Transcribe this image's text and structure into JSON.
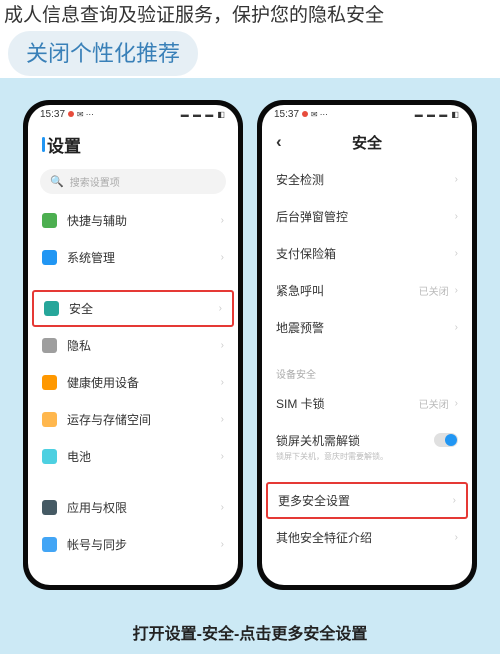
{
  "header": {
    "line": "成人信息查询及验证服务，保护您的隐私安全",
    "button": "关闭个性化推荐"
  },
  "status": {
    "time": "15:37",
    "icons": "▬ ▬ ▬ ◧"
  },
  "phone1": {
    "title": "设置",
    "search": "搜索设置项",
    "items": {
      "i0": "快捷与辅助",
      "i1": "系统管理",
      "i2": "安全",
      "i3": "隐私",
      "i4": "健康使用设备",
      "i5": "运存与存储空间",
      "i6": "电池",
      "i7": "应用与权限",
      "i8": "帐号与同步"
    }
  },
  "phone2": {
    "title": "安全",
    "items": {
      "i0": "安全检测",
      "i1": "后台弹窗管控",
      "i2": "支付保险箱",
      "i3": "紧急呼叫",
      "i3v": "已关闭",
      "i4": "地震预警",
      "sec": "设备安全",
      "i5": "SIM 卡锁",
      "i5v": "已关闭",
      "i6": "锁屏关机需解锁",
      "i6s": "锁屏下关机，意庆时需要解锁。",
      "i7": "更多安全设置",
      "i8": "其他安全特征介绍"
    }
  },
  "caption": "打开设置-安全-点击更多安全设置"
}
